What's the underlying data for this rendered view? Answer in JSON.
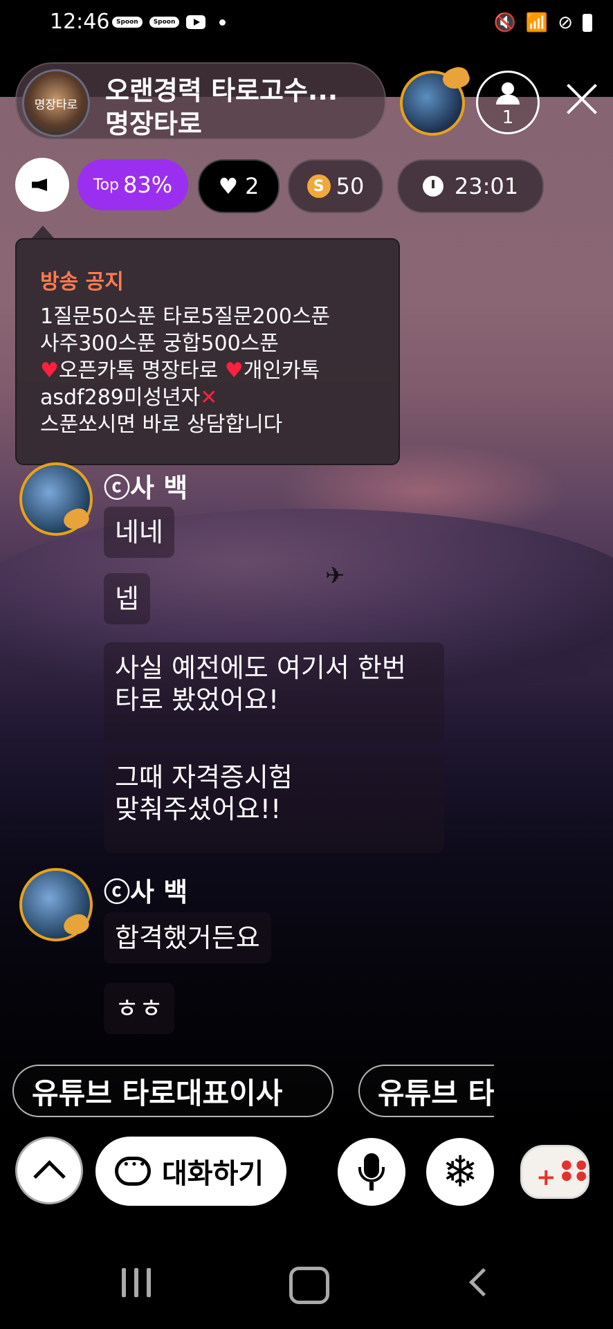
{
  "status_bar": {
    "time": "12:46",
    "notif1": "Spoon",
    "notif2": "Spoon"
  },
  "header": {
    "room_title": "오랜경력 타로고수...",
    "host_name": "명장타로",
    "avatar_text": "명장타로",
    "listener_count": "1"
  },
  "stats": {
    "top_prefix": "Top",
    "top_value": "83%",
    "likes": "2",
    "spoons": "50",
    "coin_symbol": "S",
    "timer": "23:01"
  },
  "notice": {
    "title": "방송 공지",
    "lines": [
      "1질문50스푼 타로5질문200스푼",
      "사주300스푼 궁합500스푼",
      "오픈카톡 명장타로",
      "개인카톡",
      "asdf289미성년자",
      "스푼쏘시면 바로 상담합니다"
    ]
  },
  "chat": [
    {
      "user": "ⓒ사 백",
      "messages": [
        "네네",
        "넵",
        "사실 예전에도 여기서 한번\n타로 봤었어요!",
        "그때 자격증시험\n맞춰주셨어요!!"
      ]
    },
    {
      "user": "ⓒ사 백",
      "messages": [
        "합격했거든요",
        "ㅎㅎ"
      ]
    }
  ],
  "chips": [
    "유튜브 타로대표이사",
    "유튜브 타로"
  ],
  "bottom": {
    "chat_label": "대화하기"
  },
  "colors": {
    "top_purple": "#9b2ff0",
    "notice_title": "#ff7a55",
    "gold": "#e6a21c"
  }
}
